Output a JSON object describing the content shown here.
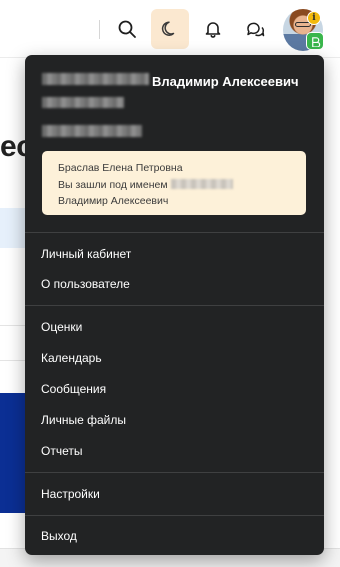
{
  "header": {
    "icons": [
      "search-icon",
      "moon-icon",
      "bell-icon",
      "chat-icon"
    ],
    "avatar_badges": [
      "info-icon",
      "logo-icon"
    ],
    "theme_button_bg": "#fbe8d0"
  },
  "background": {
    "heading_fragment": "ест"
  },
  "user_menu": {
    "user_name": "Владимир Алексеевич",
    "impersonation": {
      "line1": "Браслав Елена Петровна",
      "line2": "Вы зашли под именем",
      "line3": "Владимир Алексеевич"
    },
    "items": [
      {
        "label": "Личный кабинет"
      },
      {
        "label": "О пользователе"
      },
      {
        "label": "Оценки"
      },
      {
        "label": "Календарь"
      },
      {
        "label": "Сообщения"
      },
      {
        "label": "Личные файлы"
      },
      {
        "label": "Отчеты"
      },
      {
        "label": "Настройки"
      },
      {
        "label": "Выход"
      }
    ],
    "colors": {
      "popup_bg": "#222324",
      "impersonation_bg": "#fdf1d9",
      "text": "#ffffff"
    }
  }
}
